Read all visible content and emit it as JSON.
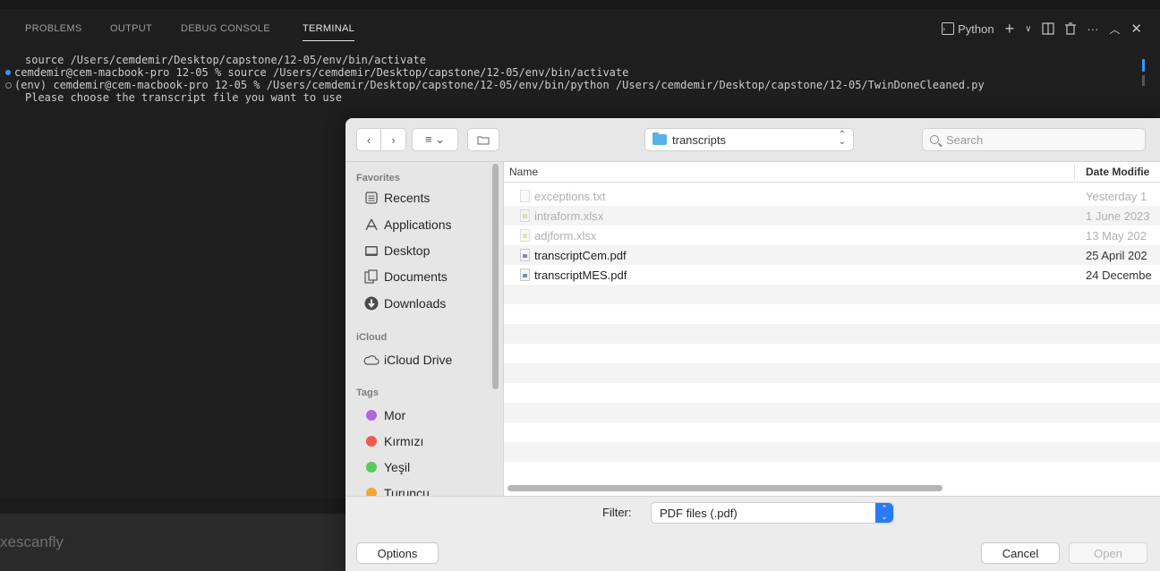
{
  "panel": {
    "tabs": [
      {
        "label": "PROBLEMS"
      },
      {
        "label": "OUTPUT"
      },
      {
        "label": "DEBUG CONSOLE"
      },
      {
        "label": "TERMINAL",
        "active": true
      }
    ],
    "terminal_profile": "Python"
  },
  "terminal": {
    "lines": [
      "source /Users/cemdemir/Desktop/capstone/12-05/env/bin/activate",
      "cemdemir@cem-macbook-pro 12-05 % source /Users/cemdemir/Desktop/capstone/12-05/env/bin/activate",
      "(env) cemdemir@cem-macbook-pro 12-05 % /Users/cemdemir/Desktop/capstone/12-05/env/bin/python /Users/cemdemir/Desktop/capstone/12-05/TwinDoneCleaned.py",
      "Please choose the transcript file you want to use"
    ]
  },
  "statusbar": {
    "text": "xescanfly"
  },
  "dialog": {
    "location": "transcripts",
    "search_placeholder": "Search",
    "sidebar": {
      "favorites_header": "Favorites",
      "favorites": [
        {
          "label": "Recents",
          "icon": "recents-icon"
        },
        {
          "label": "Applications",
          "icon": "applications-icon"
        },
        {
          "label": "Desktop",
          "icon": "desktop-icon"
        },
        {
          "label": "Documents",
          "icon": "documents-icon"
        },
        {
          "label": "Downloads",
          "icon": "downloads-icon"
        }
      ],
      "icloud_header": "iCloud",
      "icloud": [
        {
          "label": "iCloud Drive",
          "icon": "cloud-icon"
        }
      ],
      "tags_header": "Tags",
      "tags": [
        {
          "label": "Mor",
          "color": "#b366d9"
        },
        {
          "label": "Kırmızı",
          "color": "#f05a4f"
        },
        {
          "label": "Yeşil",
          "color": "#5ac85a"
        },
        {
          "label": "Turuncu",
          "color": "#f5a33a"
        }
      ]
    },
    "columns": {
      "name": "Name",
      "date": "Date Modifie"
    },
    "files": [
      {
        "name": "exceptions.txt",
        "date": "Yesterday 1",
        "enabled": false,
        "kind": "txt"
      },
      {
        "name": "intraform.xlsx",
        "date": "1 June 2023",
        "enabled": false,
        "kind": "xlsx"
      },
      {
        "name": "adjform.xlsx",
        "date": "13 May 202",
        "enabled": false,
        "kind": "xlsx"
      },
      {
        "name": "transcriptCem.pdf",
        "date": "25 April 202",
        "enabled": true,
        "kind": "pdf"
      },
      {
        "name": "transcriptMES.pdf",
        "date": "24 Decembe",
        "enabled": true,
        "kind": "pdf"
      }
    ],
    "filter_label": "Filter:",
    "filter_value": "PDF files (.pdf)",
    "buttons": {
      "options": "Options",
      "cancel": "Cancel",
      "open": "Open"
    }
  }
}
